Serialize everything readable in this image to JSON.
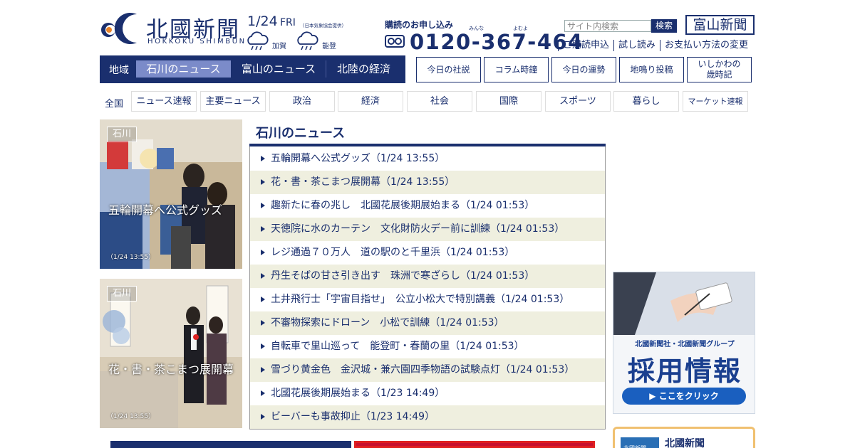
{
  "header": {
    "logo_jp": "北國新聞",
    "logo_en": "HOKKOKU SHIMBUN",
    "date": "1/24",
    "weekday": "FRI",
    "weather_credit": "（日本気象協会提供）",
    "weather": [
      {
        "area": "加賀",
        "icon": "cloud-rain-icon"
      },
      {
        "area": "能登",
        "icon": "cloud-rain-icon"
      }
    ],
    "subscription_title": "購読のお申し込み",
    "subscription_ruby": [
      "みんな",
      "よむよ"
    ],
    "freedial_icon": "freedial-icon",
    "phone": "0120-367-464",
    "search_placeholder": "サイト内検索",
    "search_button": "検索",
    "toyama_button": "富山新聞",
    "links": [
      "ご購読申込",
      "試し読み",
      "お支払い方法の変更"
    ]
  },
  "region_nav": {
    "label": "地域",
    "tabs": [
      {
        "label": "石川のニュース",
        "active": true
      },
      {
        "label": "富山のニュース",
        "active": false
      },
      {
        "label": "北陸の経済",
        "active": false
      }
    ]
  },
  "feature_buttons": [
    "今日の社説",
    "コラム時鐘",
    "今日の運勢",
    "地鳴り投稿",
    "いしかわの歳時記"
  ],
  "categories": {
    "all_label": "全国",
    "items": [
      "ニュース速報",
      "主要ニュース",
      "政治",
      "経済",
      "社会",
      "国際",
      "スポーツ",
      "暮らし",
      "マーケット速報"
    ]
  },
  "photos": [
    {
      "badge": "石川",
      "caption": "五輪開幕へ公式グッズ",
      "time": "（1/24 13:55）"
    },
    {
      "badge": "石川",
      "caption": "花・書・茶こまつ展開幕",
      "time": "（1/24 13:55）"
    }
  ],
  "news": {
    "heading": "石川のニュース",
    "items": [
      "五輪開幕へ公式グッズ（1/24 13:55）",
      "花・書・茶こまつ展開幕（1/24 13:55）",
      "趣新たに春の兆し　北國花展後期展始まる（1/24 01:53）",
      "天徳院に水のカーテン　文化財防火デー前に訓練（1/24 01:53）",
      "レジ通過７０万人　道の駅のと千里浜（1/24 01:53）",
      "丹生そばの甘さ引き出す　珠洲で寒ざらし（1/24 01:53）",
      "土井飛行士「宇宙目指せ」　公立小松大で特別講義（1/24 01:53）",
      "不審物探索にドローン　小松で訓練（1/24 01:53）",
      "自転車で里山巡って　能登町・春蘭の里（1/24 01:53）",
      "雪づり黄金色　金沢城・兼六園四季物語の試験点灯（1/24 01:53）",
      "北國花展後期展始まる（1/23 14:49）",
      "ビーバーも事故抑止（1/23 14:49）"
    ]
  },
  "ads": {
    "recruit_line1": "北國新聞社・北國新聞グループ",
    "recruit_title": "採用情報",
    "recruit_button": "▶ ここをクリック",
    "hokkoku_ad_text": "北國新聞",
    "hokkoku_ad_logo_text": "北國新聞"
  },
  "colors": {
    "brand_navy": "#1a2f6e",
    "active_tab": "#7b8bc9",
    "row_alt": "#efefdf",
    "logo_orange": "#e8832a"
  }
}
